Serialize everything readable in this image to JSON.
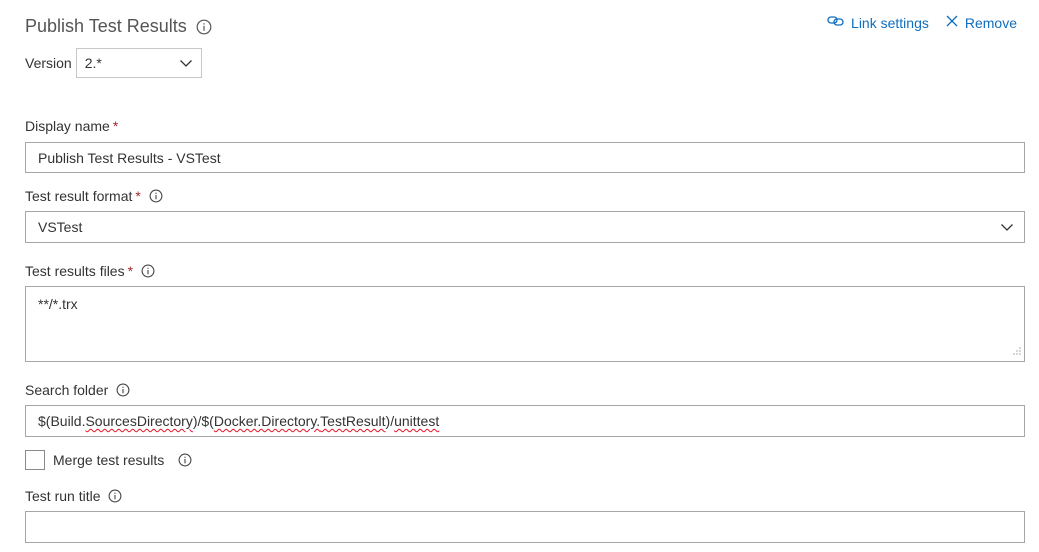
{
  "header": {
    "title": "Publish Test Results",
    "link_settings_label": "Link settings",
    "remove_label": "Remove"
  },
  "version": {
    "label": "Version",
    "value": "2.*"
  },
  "display_name": {
    "label": "Display name",
    "required": "*",
    "value": "Publish Test Results - VSTest"
  },
  "test_result_format": {
    "label": "Test result format",
    "required": "*",
    "value": "VSTest"
  },
  "test_results_files": {
    "label": "Test results files",
    "required": "*",
    "value": "**/*.trx"
  },
  "search_folder": {
    "label": "Search folder",
    "value_parts": [
      "$(Build.",
      "SourcesDirectory",
      ")/$(",
      "Docker.Directory.",
      "TestResult",
      ")/",
      "unittest"
    ]
  },
  "merge_test_results": {
    "label": "Merge test results",
    "checked": false
  },
  "test_run_title": {
    "label": "Test run title",
    "value": ""
  },
  "colors": {
    "accent": "#106ebe",
    "required": "#a4262c",
    "spellcheck": "#e81123"
  }
}
